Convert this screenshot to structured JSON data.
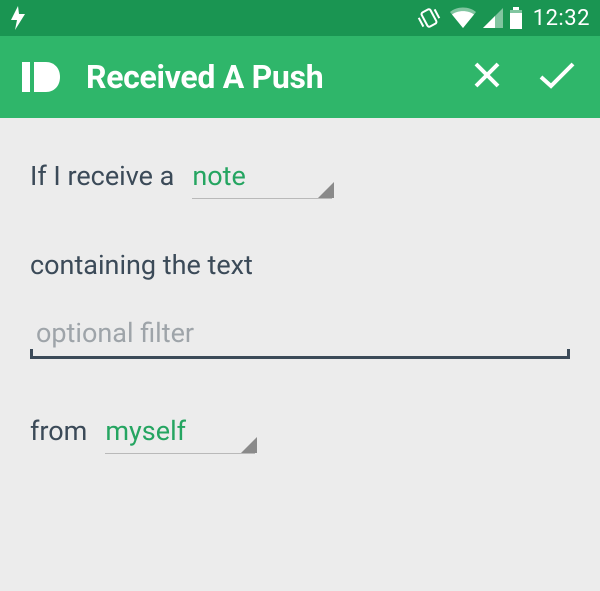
{
  "status": {
    "time": "12:32"
  },
  "header": {
    "title": "Received A Push"
  },
  "form": {
    "line1_prefix": "If I receive a",
    "type_value": "note",
    "line2_label": "containing the text",
    "filter_placeholder": "optional filter",
    "filter_value": "",
    "line3_prefix": "from",
    "from_value": "myself"
  },
  "colors": {
    "status_bg": "#1a9552",
    "action_bg": "#2fb66a",
    "accent": "#25a561",
    "text": "#3b4a58"
  }
}
